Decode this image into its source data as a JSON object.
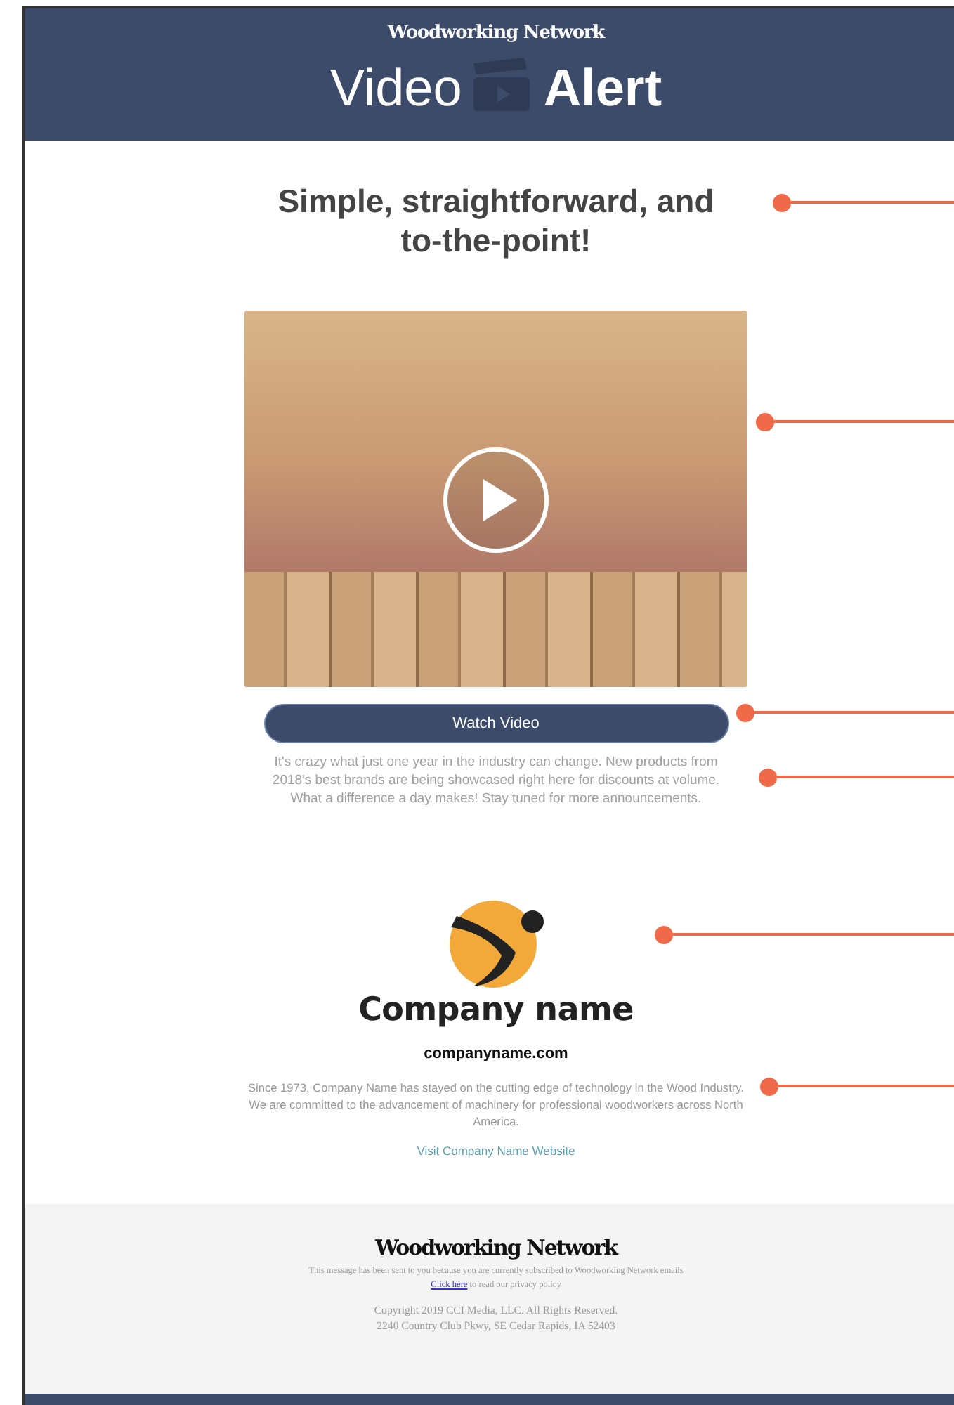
{
  "header": {
    "brand": "Woodworking Network",
    "title_light": "Video",
    "title_bold": "Alert"
  },
  "headline": "Simple, straightforward, and to-the-point!",
  "video": {
    "button": "Watch Video",
    "description": "It's crazy what just one year in the industry can change. New products from 2018's best brands are being showcased right here for discounts at volume. What a difference a day makes! Stay tuned for more announcements."
  },
  "company": {
    "logo_text": "Company name",
    "domain": "companyname.com",
    "about": "Since 1973, Company Name has stayed on the cutting edge of technology in the Wood Industry. We are committed to the advancement of machinery for professional woodworkers across North America.",
    "link": "Visit Company Name Website"
  },
  "footer": {
    "brand": "Woodworking Network",
    "notice": "This message has been sent to you because you are currently subscribed to Woodworking Network emails",
    "privacy_link": "Click here",
    "privacy_text": "to read our privacy policy",
    "copyright": "Copyright 2019 CCI Media, LLC. All Rights Reserved.",
    "address": "2240 Country Club Pkwy, SE Cedar Rapids, IA 52403"
  }
}
